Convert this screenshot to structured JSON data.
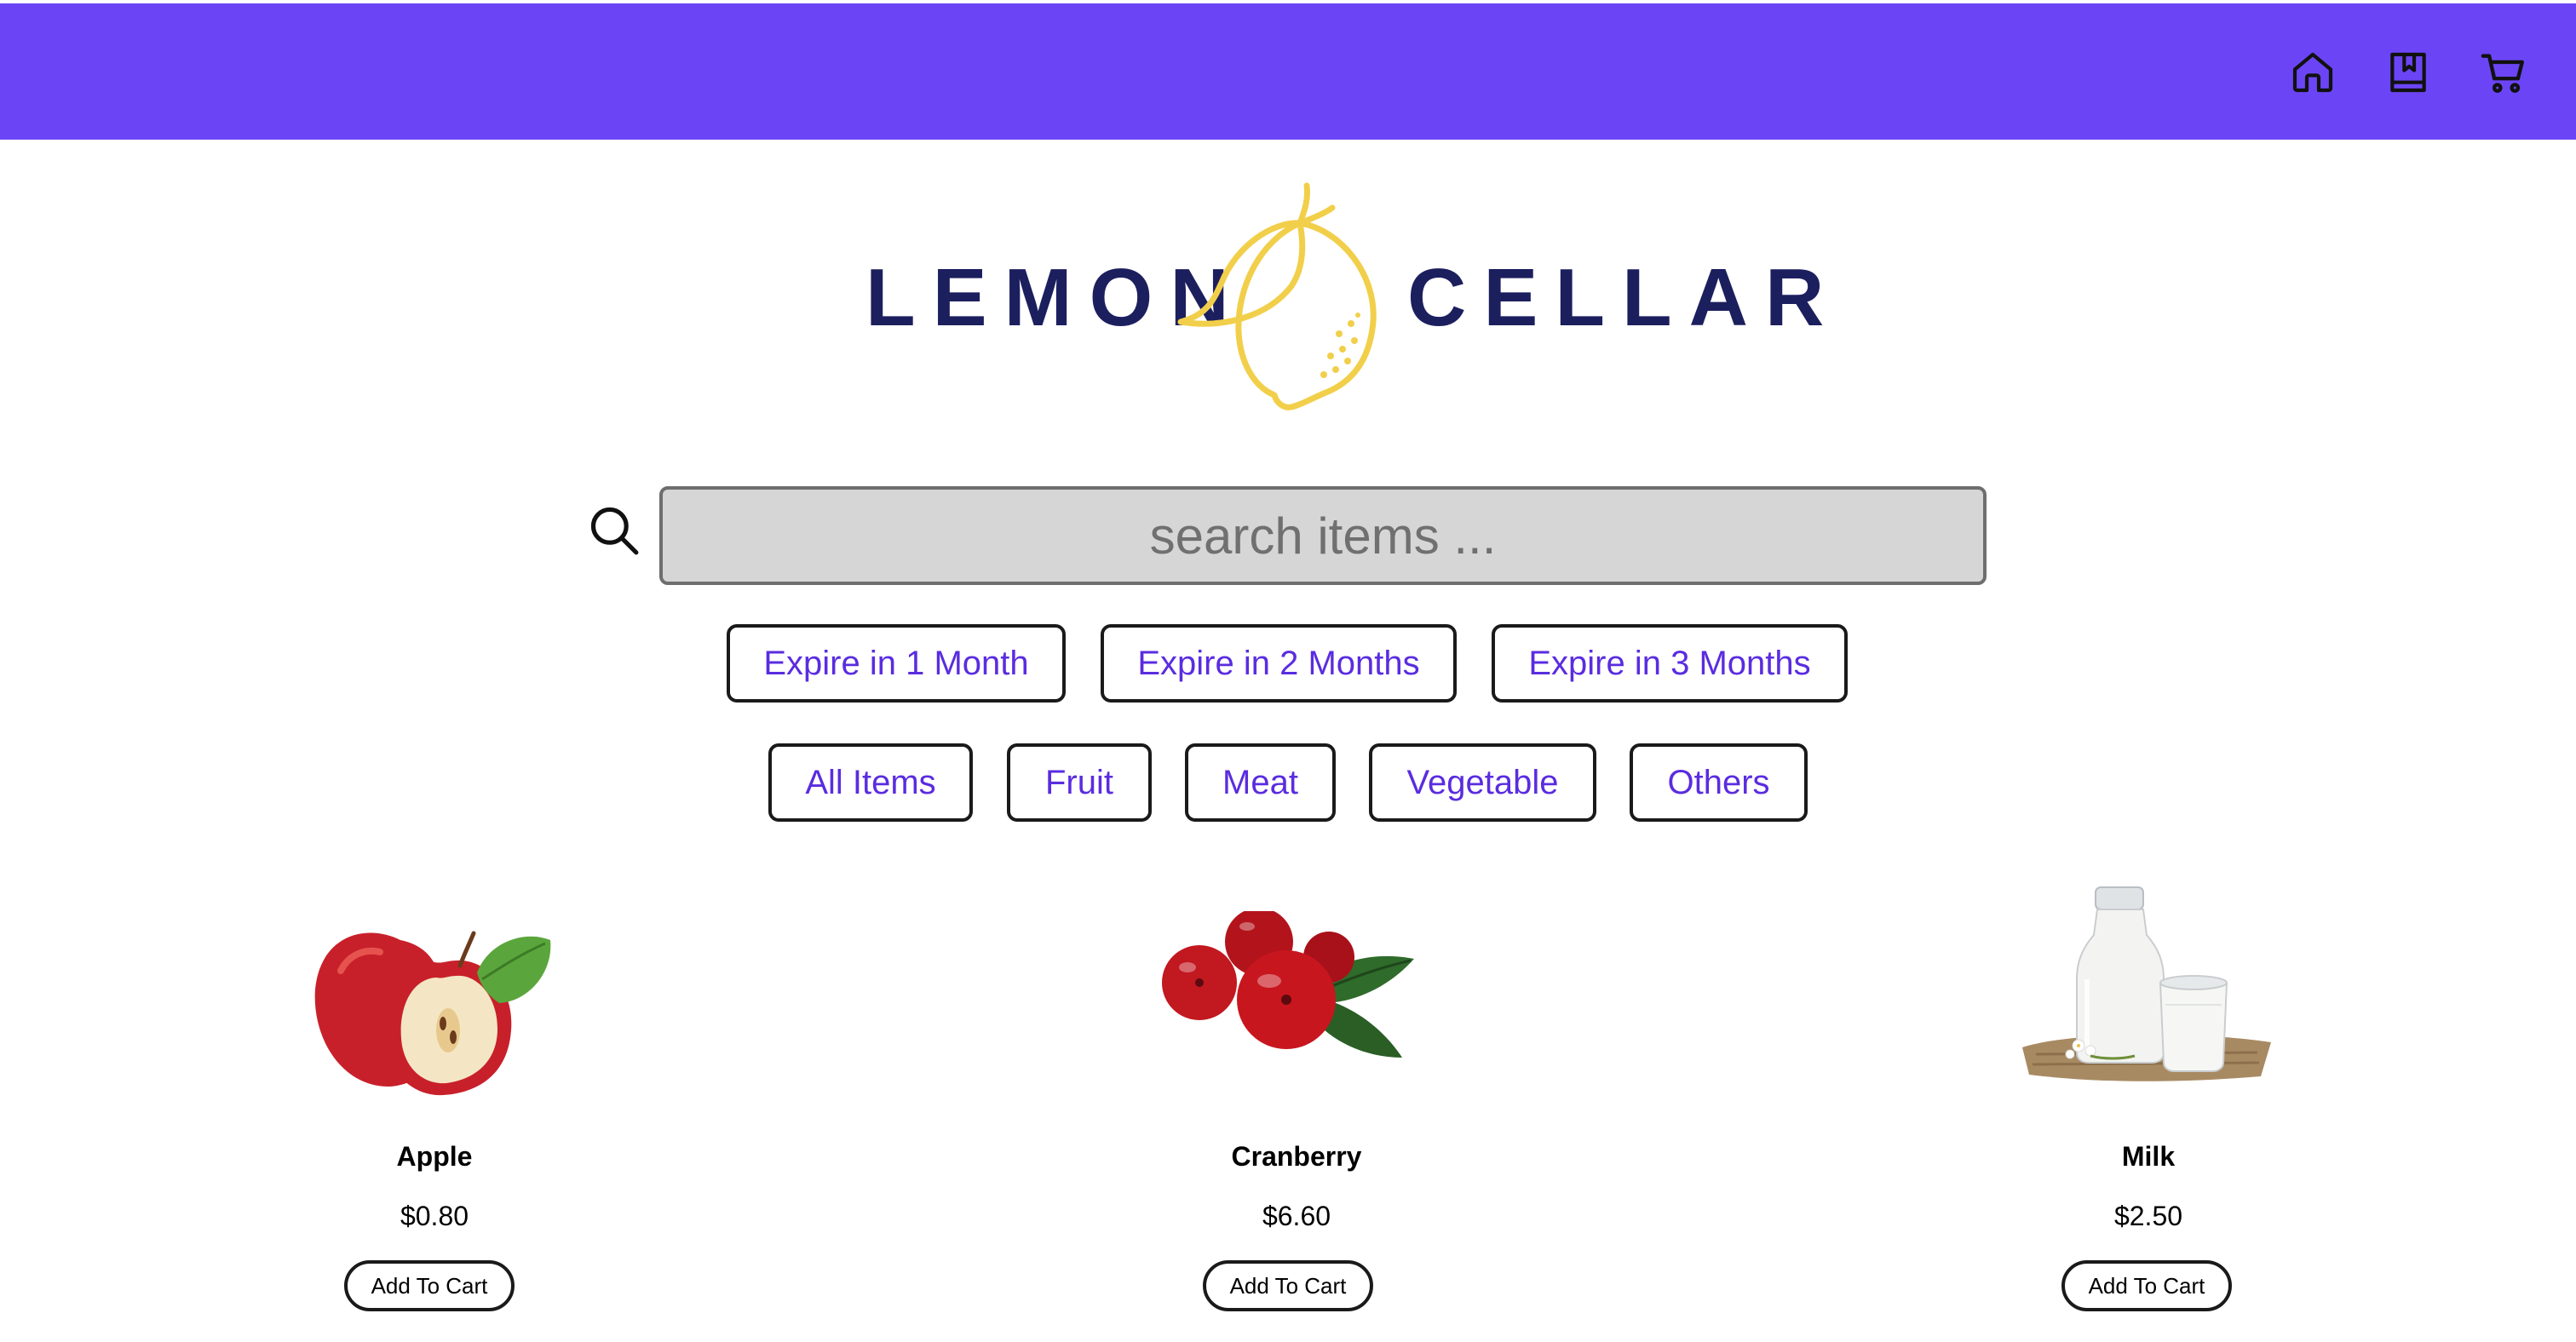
{
  "header": {
    "background": "#6b45f5",
    "icons": [
      {
        "name": "home-icon"
      },
      {
        "name": "bookmark-book-icon"
      },
      {
        "name": "shopping-cart-icon"
      }
    ]
  },
  "brand": {
    "word_left": "LEMON",
    "word_right": "CELLAR",
    "text_color": "#1c1f5e",
    "lemon_color": "#f2cf4a"
  },
  "search": {
    "placeholder": "search items ...",
    "value": ""
  },
  "expiry_filters": [
    {
      "label": "Expire in 1 Month"
    },
    {
      "label": "Expire in 2 Months"
    },
    {
      "label": "Expire in 3 Months"
    }
  ],
  "category_filters": [
    {
      "label": "All Items"
    },
    {
      "label": "Fruit"
    },
    {
      "label": "Meat"
    },
    {
      "label": "Vegetable"
    },
    {
      "label": "Others"
    }
  ],
  "products": [
    {
      "name": "Apple",
      "price": "$0.80",
      "button": "Add To Cart"
    },
    {
      "name": "Cranberry",
      "price": "$6.60",
      "button": "Add To Cart"
    },
    {
      "name": "Milk",
      "price": "$2.50",
      "button": "Add To Cart"
    }
  ],
  "colors": {
    "accent_text": "#5a2ce0",
    "search_bg": "#d6d6d6"
  }
}
